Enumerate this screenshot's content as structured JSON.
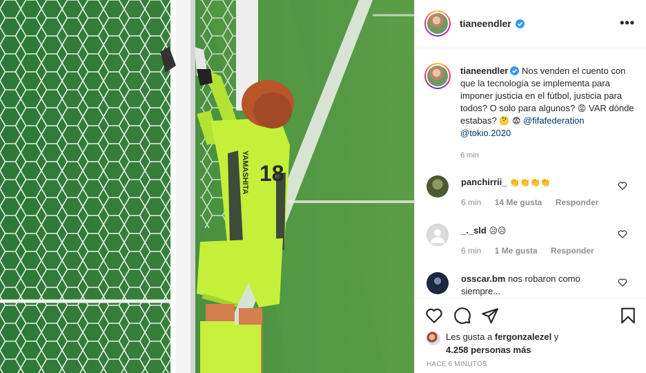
{
  "post": {
    "username": "tianeendler",
    "more_label": "•••"
  },
  "caption": {
    "username": "tianeendler",
    "text_before": "Nos venden el cuento con que la tecnología se implementa para imponer justicia en el fútbol, justicia para todos? O solo para algunos?",
    "text_emoji_1": "😡",
    "text_middle": "VAR dónde estabas?",
    "text_emoji_2": "🤔",
    "text_emoji_3": "😨",
    "mention_1": "@fifafederation",
    "mention_2": "@tokio.2020",
    "time": "6 min"
  },
  "comments": [
    {
      "username": "panchirrii_",
      "text": "👏👏👏👏",
      "time": "6 min",
      "likes": "14 Me gusta",
      "reply": "Responder",
      "avatar_color": "#5b6b3e"
    },
    {
      "username": "_._sld",
      "text": "😥😥",
      "time": "6 min",
      "likes": "1 Me gusta",
      "reply": "Responder",
      "avatar_color": "#dbdbdb"
    },
    {
      "username": "osscar.bm",
      "text": "nos robaron como siempre...",
      "avatar_color": "#1c2840"
    }
  ],
  "likes": {
    "prefix": "Les gusta a",
    "user": "fergonzalezel",
    "connector": "y",
    "count": "4.258 personas más"
  },
  "timestamp": "HACE 6 MINUTOS",
  "icons": {
    "like": "heart-icon",
    "comment": "comment-icon",
    "share": "share-icon",
    "save": "bookmark-icon",
    "verified": "verified-badge-icon",
    "more": "more-options-icon"
  },
  "colors": {
    "verified": "#3897f0",
    "link": "#00376b",
    "secondary_text": "#8e8e8e",
    "jersey": "#c8f23a"
  },
  "photo": {
    "jersey_name": "YAMASHITA",
    "jersey_number": "18"
  }
}
